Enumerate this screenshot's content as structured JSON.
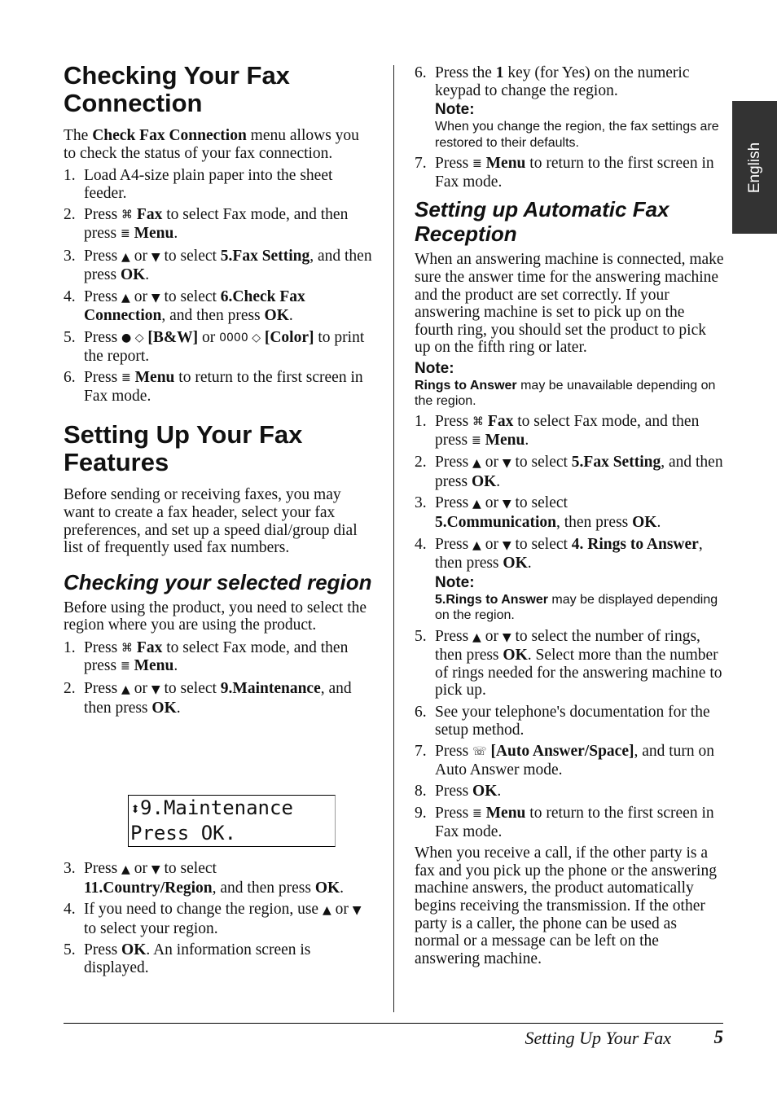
{
  "side_tab": {
    "label": "English"
  },
  "footer": {
    "section_title": "Setting Up Your Fax",
    "page_number": "5"
  },
  "lcd_display": {
    "line1": "9.Maintenance",
    "line2": "Press OK."
  },
  "left": {
    "h1_check": "Checking Your Fax Connection",
    "intro_check": {
      "a": "The ",
      "b": "Check Fax Connection",
      "c": " menu allows you to check the status of your fax connection."
    },
    "check_steps": [
      {
        "num": "1.",
        "text": "Load A4-size plain paper into the sheet feeder."
      },
      {
        "num": "2.",
        "a": "Press ",
        "b": "Fax",
        "c": " to select Fax mode, and then press ",
        "d": "Menu",
        "e": "."
      },
      {
        "num": "3.",
        "a": "Press ",
        "or": " or ",
        "c": " to select ",
        "d": "5.Fax Setting",
        "e": ", and then press ",
        "f": "OK",
        "g": "."
      },
      {
        "num": "4.",
        "a": "Press ",
        "or": " or ",
        "c": " to select ",
        "d": "6.Check Fax Connection",
        "e": ", and then press ",
        "f": "OK",
        "g": "."
      },
      {
        "num": "5.",
        "a": "Press ",
        "bw": "[B&W]",
        "or": " or ",
        "color": "[Color]",
        "e": " to print the report."
      },
      {
        "num": "6.",
        "a": "Press ",
        "b": "Menu",
        "c": " to return to the first screen in Fax mode."
      }
    ],
    "h1_setup": "Setting Up Your Fax Features",
    "intro_setup": "Before sending or receiving faxes, you may want to create a fax header, select your fax preferences, and set up a speed dial/group dial list of frequently used fax numbers.",
    "h2_region": "Checking your selected region",
    "intro_region": "Before using the product, you need to select the region where you are using the product.",
    "region_steps": [
      {
        "num": "1.",
        "a": "Press ",
        "b": "Fax",
        "c": " to select Fax mode, and then press ",
        "d": "Menu",
        "e": "."
      },
      {
        "num": "2.",
        "a": "Press ",
        "or": " or ",
        "c": " to select ",
        "d": "9.Maintenance",
        "e": ", and then press ",
        "f": "OK",
        "g": "."
      },
      {
        "num": "3.",
        "a": "Press ",
        "or": " or ",
        "c": " to select ",
        "d": "11.Country/Region",
        "e": ", and then press ",
        "f": "OK",
        "g": "."
      },
      {
        "num": "4.",
        "a": "If you need to change the region, use ",
        "or": " or ",
        "c": " to select your region."
      },
      {
        "num": "5.",
        "a": "Press ",
        "b": "OK",
        "c": ". An information screen is displayed."
      }
    ]
  },
  "right": {
    "region_steps_cont": [
      {
        "num": "6.",
        "a": "Press the ",
        "b": "1",
        "c": " key (for Yes) on the numeric keypad to change the region."
      },
      {
        "num": "7.",
        "a": "Press ",
        "b": "Menu",
        "c": " to return to the first screen in Fax mode."
      }
    ],
    "note1": {
      "head": "Note:",
      "body": "When you change the region, the fax settings are restored to their defaults."
    },
    "h2_auto": "Setting up Automatic Fax Reception",
    "intro_auto": "When an answering machine is connected, make sure the answer time for the answering machine and the product are set correctly. If your answering machine is set to pick up on the fourth ring, you should set the product to pick up on the fifth ring or later.",
    "note2": {
      "head": "Note:",
      "b": "Rings to Answer",
      "body": " may be unavailable depending on the region."
    },
    "auto_steps": [
      {
        "num": "1.",
        "a": "Press ",
        "b": "Fax",
        "c": " to select Fax mode, and then press ",
        "d": "Menu",
        "e": "."
      },
      {
        "num": "2.",
        "a": "Press ",
        "or": " or ",
        "c": " to select ",
        "d": "5.Fax Setting",
        "e": ", and then press ",
        "f": "OK",
        "g": "."
      },
      {
        "num": "3.",
        "a": "Press ",
        "or": " or ",
        "c": " to select ",
        "d": "5.Communication",
        "e": ", then press ",
        "f": "OK",
        "g": "."
      },
      {
        "num": "4.",
        "a": "Press ",
        "or": " or ",
        "c": " to select ",
        "d": "4. Rings to Answer",
        "e": ", then press ",
        "f": "OK",
        "g": "."
      },
      {
        "num": "5.",
        "a": "Press ",
        "or": " or ",
        "c": " to select the number of rings, then press ",
        "f": "OK",
        "g": ". Select more than the number of rings needed for the answering machine to pick up."
      },
      {
        "num": "6.",
        "text": "See your telephone's documentation for the setup method."
      },
      {
        "num": "7.",
        "a": "Press ",
        "b": "[Auto Answer/Space]",
        "c": ", and turn on Auto Answer mode."
      },
      {
        "num": "8.",
        "a": "Press ",
        "b": "OK",
        "c": "."
      },
      {
        "num": "9.",
        "a": "Press ",
        "b": "Menu",
        "c": " to return to the first screen in Fax mode."
      }
    ],
    "note3": {
      "head": "Note:",
      "b": "5.Rings to Answer",
      "body": " may be displayed depending on the region."
    },
    "outro_auto": "When you receive a call, if the other party is a fax and you pick up the phone or the answering machine answers, the product automatically begins receiving the transmission. If the other party is a caller, the phone can be used as normal or a message can be left on the answering machine."
  },
  "icons": {
    "fax": "⌘",
    "menu": "≣",
    "up": "▲",
    "down": "▼",
    "bw": "● ◇",
    "color": "0000 ◇",
    "auto": "☏",
    "updown": "⬍"
  }
}
